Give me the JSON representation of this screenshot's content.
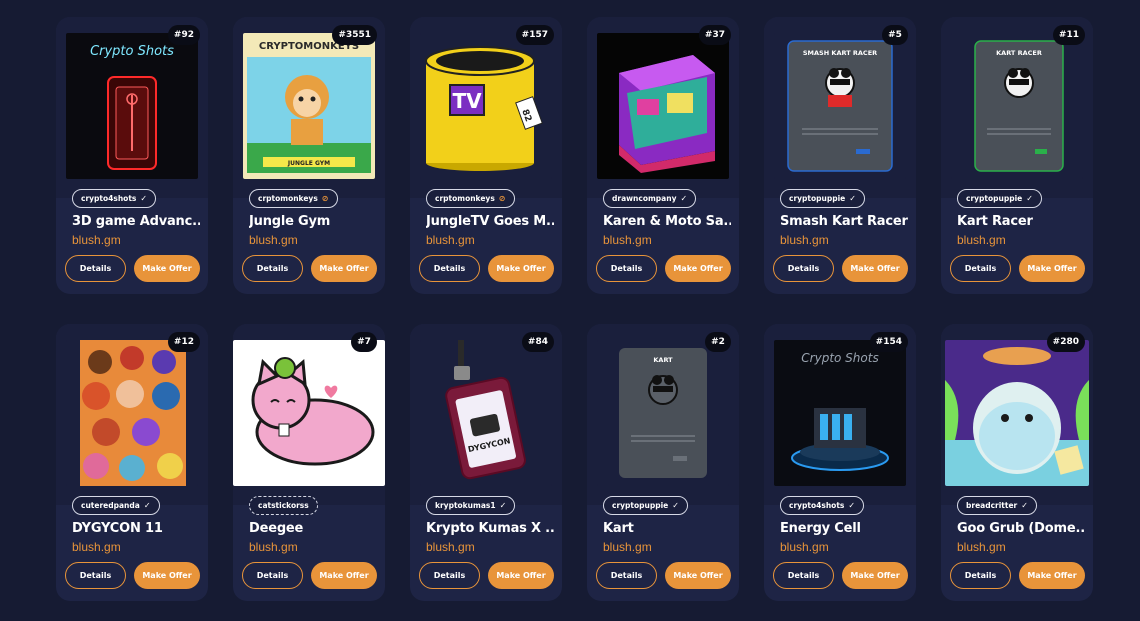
{
  "buttons": {
    "details": "Details",
    "offer": "Make Offer"
  },
  "colors": {
    "accent": "#e8943a",
    "background": "#161b33",
    "card": "#1e2445"
  },
  "cards": [
    {
      "count": "#92",
      "creator": "crypto4shots",
      "verify": "check",
      "title": "3D game Advanc...",
      "owner": "blush.gm",
      "art_text": "Crypto Shots"
    },
    {
      "count": "#3551",
      "creator": "crptomonkeys",
      "verify": "gold",
      "title": "Jungle Gym",
      "owner": "blush.gm",
      "art_text": "CRYPTOMONKEYS",
      "art_sub": "JUNGLE GYM"
    },
    {
      "count": "#157",
      "creator": "crptomonkeys",
      "verify": "gold",
      "title": "JungleTV Goes M...",
      "owner": "blush.gm",
      "art_text": "TV",
      "art_sub": "82"
    },
    {
      "count": "#37",
      "creator": "drawncompany",
      "verify": "check",
      "title": "Karen & Moto Sa...",
      "owner": "blush.gm"
    },
    {
      "count": "#5",
      "creator": "cryptopuppie",
      "verify": "check",
      "title": "Smash Kart Racer",
      "owner": "blush.gm",
      "art_text": "SMASH KART RACER"
    },
    {
      "count": "#11",
      "creator": "cryptopuppie",
      "verify": "check",
      "title": "Kart Racer",
      "owner": "blush.gm",
      "art_text": "KART RACER"
    },
    {
      "count": "#12",
      "creator": "cuteredpanda",
      "verify": "check",
      "title": "DYGYCON 11",
      "owner": "blush.gm"
    },
    {
      "count": "#7",
      "creator": "catstickorss",
      "verify": "none",
      "title": "Deegee",
      "owner": "blush.gm"
    },
    {
      "count": "#84",
      "creator": "kryptokumas1",
      "verify": "check",
      "title": "Krypto Kumas X ...",
      "owner": "blush.gm",
      "art_text": "DYGYCON"
    },
    {
      "count": "#2",
      "creator": "cryptopuppie",
      "verify": "check",
      "title": "Kart",
      "owner": "blush.gm",
      "art_text": "KART"
    },
    {
      "count": "#154",
      "creator": "crypto4shots",
      "verify": "check",
      "title": "Energy Cell",
      "owner": "blush.gm",
      "art_text": "Crypto Shots"
    },
    {
      "count": "#280",
      "creator": "breadcritter",
      "verify": "check",
      "title": "Goo Grub (Dome...",
      "owner": "blush.gm"
    }
  ]
}
